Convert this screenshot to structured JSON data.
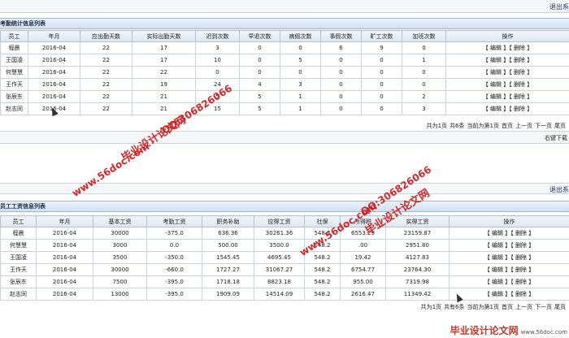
{
  "top": {
    "exit_label": "退出系"
  },
  "panel1": {
    "title": "考勤统计信息列表",
    "headers": [
      "员工",
      "年月",
      "应出勤天数",
      "实际出勤天数",
      "迟到次数",
      "早退次数",
      "病假次数",
      "事假次数",
      "旷工次数",
      "加班次数",
      "操作"
    ],
    "rows": [
      [
        "程晨",
        "2016-04",
        "22",
        "17",
        "3",
        "0",
        "0",
        "6",
        "9",
        "0"
      ],
      [
        "王国凌",
        "2016-04",
        "22",
        "17",
        "10",
        "0",
        "5",
        "0",
        "0",
        "1"
      ],
      [
        "何慧慧",
        "2016-04",
        "22",
        "22",
        "0",
        "0",
        "0",
        "0",
        "0",
        "0"
      ],
      [
        "王作天",
        "2016-04",
        "22",
        "19",
        "24",
        "4",
        "3",
        "0",
        "0",
        "0"
      ],
      [
        "张辰东",
        "2016-04",
        "22",
        "21",
        "5",
        "5",
        "1",
        "0",
        "0",
        "2"
      ],
      [
        "赵志同",
        "2016-04",
        "22",
        "21",
        "15",
        "5",
        "1",
        "0",
        "0",
        "3"
      ]
    ],
    "op_edit": "【 编辑 】",
    "op_delete": "【 删除 】",
    "pager": [
      "共为1页",
      "共6条",
      "当前为第1页",
      "首页",
      "上一页",
      "下一页",
      "尾页"
    ]
  },
  "mid": {
    "download_label": "右键下载"
  },
  "panel2_exit": "退出系",
  "panel2": {
    "title": "员工工资信息列表",
    "headers": [
      "员工",
      "年月",
      "基本工资",
      "考勤工资",
      "职务补助",
      "应得工资",
      "社保",
      "所得税",
      "实得工资",
      "操作"
    ],
    "rows": [
      [
        "程晨",
        "2016-04",
        "30000",
        "-375.0",
        "636.36",
        "30261.36",
        "548.2",
        "6553.29",
        "23159.87"
      ],
      [
        "何慧慧",
        "2016-04",
        "3000",
        "0.0",
        "500.00",
        "3500.0",
        "548.2",
        ".00",
        "2951.80"
      ],
      [
        "王国凌",
        "2016-04",
        "3500",
        "-350.0",
        "1545.45",
        "4695.45",
        "548.2",
        "19.42",
        "4127.83"
      ],
      [
        "王作天",
        "2016-04",
        "30000",
        "-660.0",
        "1727.27",
        "31067.27",
        "548.2",
        "6754.77",
        "23764.30"
      ],
      [
        "张辰东",
        "2016-04",
        "7500",
        "-395.0",
        "1718.18",
        "8823.18",
        "548.2",
        "955.00",
        "7319.98"
      ],
      [
        "赵志同",
        "2016-04",
        "13000",
        "-395.0",
        "1909.09",
        "14514.09",
        "548.2",
        "2616.47",
        "11349.42"
      ]
    ],
    "op_edit": "【 编辑 】",
    "op_delete": "【 删除 】",
    "pager": [
      "共为1页",
      "共有6条",
      "当前为第1页",
      "首页",
      "上一页",
      "下一页",
      "尾页"
    ]
  },
  "watermarks": {
    "site": "www.56doc.com",
    "name": "毕业设计论文网",
    "qq": "QQ:306826066"
  },
  "footer": {
    "logo": "毕业设计论文网",
    "url": "www.56doc.com"
  },
  "colors": {
    "watermark": "#d21c1c",
    "header_bg": "#dde6f0",
    "border": "#b5c3d2"
  }
}
